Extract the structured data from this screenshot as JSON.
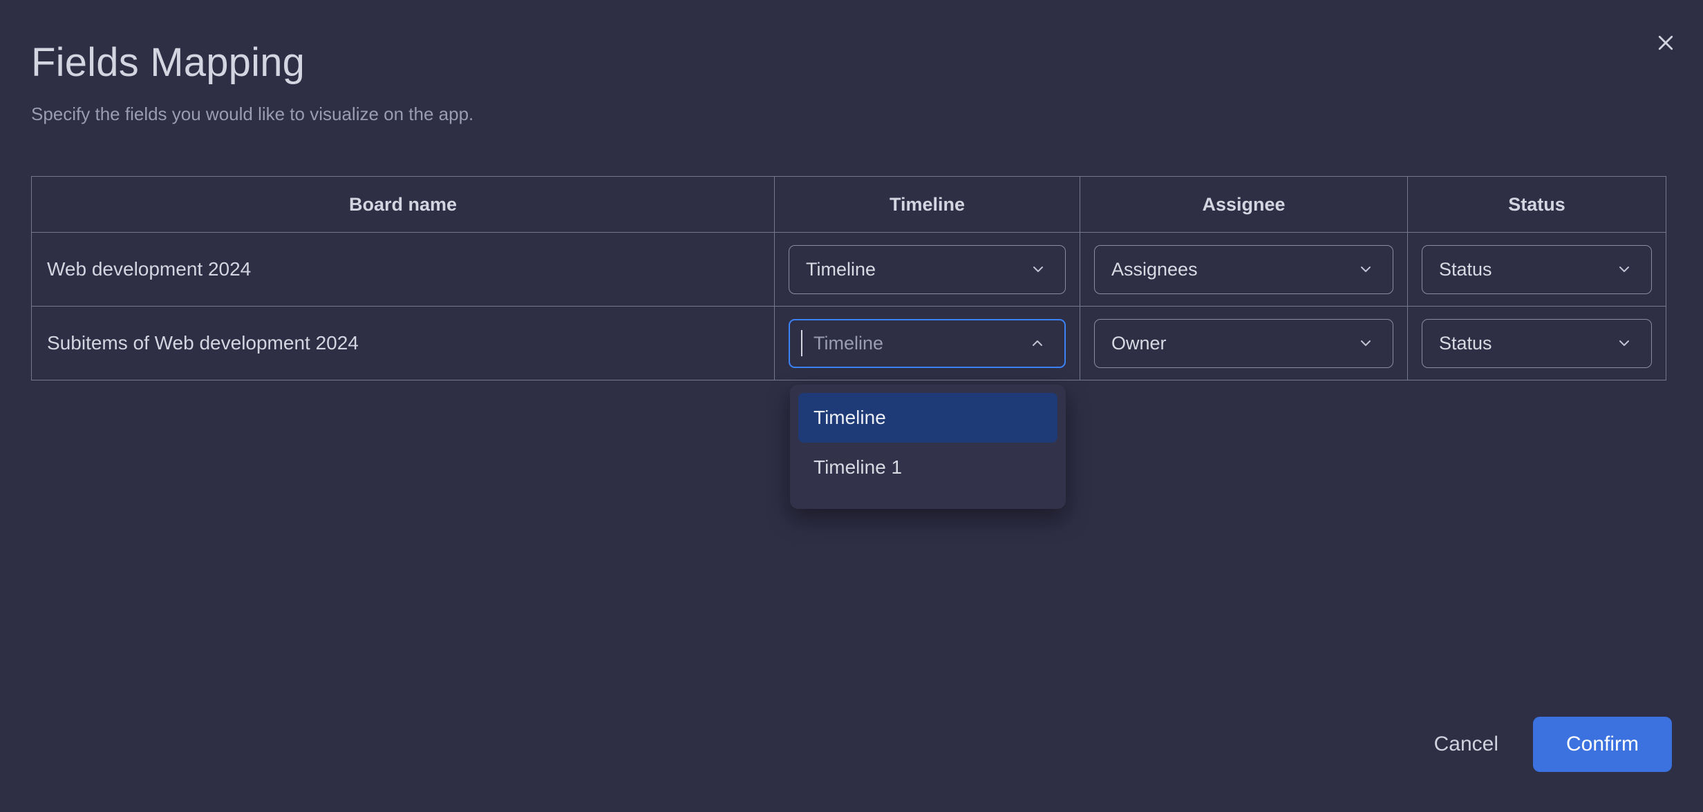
{
  "dialog": {
    "title": "Fields Mapping",
    "subtitle": "Specify the fields you would like to visualize on the app.",
    "close_icon": "close-icon"
  },
  "table": {
    "columns": [
      {
        "key": "board",
        "label": "Board name"
      },
      {
        "key": "timeline",
        "label": "Timeline"
      },
      {
        "key": "assignee",
        "label": "Assignee"
      },
      {
        "key": "status",
        "label": "Status"
      }
    ],
    "rows": [
      {
        "board_name": "Web development 2024",
        "timeline": {
          "value": "Timeline",
          "state": "closed",
          "caret": "chevron-down-icon"
        },
        "assignee": {
          "value": "Assignees",
          "state": "closed",
          "caret": "chevron-down-icon"
        },
        "status": {
          "value": "Status",
          "state": "closed",
          "caret": "chevron-down-icon"
        }
      },
      {
        "board_name": "Subitems of Web development 2024",
        "timeline": {
          "value": "",
          "placeholder": "Timeline",
          "state": "open",
          "caret": "chevron-up-icon"
        },
        "assignee": {
          "value": "Owner",
          "state": "closed",
          "caret": "chevron-down-icon"
        },
        "status": {
          "value": "Status",
          "state": "closed",
          "caret": "chevron-down-icon"
        }
      }
    ]
  },
  "dropdown": {
    "open_for": "row2-timeline",
    "options": [
      {
        "label": "Timeline",
        "selected": true
      },
      {
        "label": "Timeline 1",
        "selected": false
      }
    ]
  },
  "footer": {
    "cancel_label": "Cancel",
    "confirm_label": "Confirm"
  },
  "colors": {
    "background": "#2e2e45",
    "panel": "#32324a",
    "accent": "#3b72e0",
    "focus_border": "#3b82f6",
    "option_selected": "#1e3b77",
    "text_primary": "#d3d5e0",
    "text_muted": "#9a9cb0",
    "border": "#767890"
  }
}
